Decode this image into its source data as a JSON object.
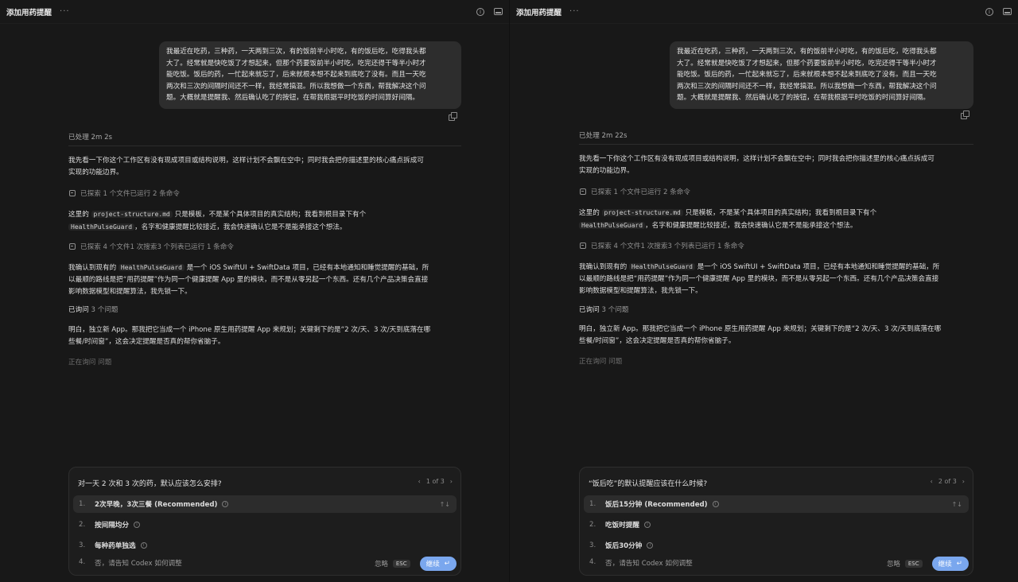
{
  "app": {
    "title": "添加用药提醒",
    "more": "···"
  },
  "conversation": {
    "user_message_lines": [
      "我最近在吃药，三种药，一天两到三次，有的饭前半小时吃，有的饭后吃，吃得我头都",
      "大了。经常就是快吃饭了才想起来，但那个药要饭前半小时吃，吃完还得干等半小时才",
      "能吃饭。饭后的药，一忙起来就忘了，后来就根本想不起来到底吃了没有。而且一天吃",
      "两次和三次的间隔时间还不一样，我经常搞混。所以我想做一个东西，帮我解决这个问",
      "题。大概就是提醒我、然后确认吃了的按钮，在帮我根据平时吃饭的时间算好间隔。"
    ],
    "intro_lines": [
      "我先看一下你这个工作区有没有现成项目或结构说明，这样计划不会飘在空中；同时我会把你描述里的核心痛点拆成可",
      "实现的功能边界。"
    ],
    "explore1": "已探索 1 个文件已运行 2 条命令",
    "para2": {
      "a": "这里的",
      "code1": "project-structure.md",
      "b": "只是模板，不是某个具体项目的真实结构；我看到根目录下有个",
      "code2": "HealthPulseGuard",
      "c": "，名字和健康提醒比较接近，我会快速确认它是不是能承接这个想法。"
    },
    "explore2": "已探索 4 个文件1 次搜索3 个列表已运行 1 条命令",
    "para3": {
      "a": "我确认到现有的",
      "code": "HealthPulseGuard",
      "b": "是一个 iOS SwiftUI + SwiftData 项目，已经有本地通知和睡觉提醒的基础，所",
      "line2": "以最顺的路线是把“用药提醒”作为同一个健康提醒 App 里的模块，而不是从零另起一个东西。还有几个产品决策会直接",
      "line3": "影响数据模型和提醒算法，我先锁一下。"
    },
    "asked_prefix": "已询问",
    "asked_count": "3 个问题",
    "para4_lines": [
      "明白，独立新 App。那我把它当成一个 iPhone 原生用药提醒 App 来规划；关键剩下的是“2 次/天、3 次/天到底落在哪",
      "些餐/时间窗”，这会决定提醒是否真的帮你省脑子。"
    ],
    "asking_prefix": "正在询问",
    "asking_suffix": "问题"
  },
  "panes": [
    {
      "elapsed": "已处理 2m 2s",
      "question": {
        "title": "对一天 2 次和 3 次的药，默认应该怎么安排?",
        "pager": "1 of 3",
        "options": [
          {
            "num": "1.",
            "label": "2次早晚，3次三餐 (Recommended)"
          },
          {
            "num": "2.",
            "label": "按间隔均分"
          },
          {
            "num": "3.",
            "label": "每种药单独选"
          }
        ]
      }
    },
    {
      "elapsed": "已处理 2m 22s",
      "question": {
        "title": "“饭后吃”的默认提醒应该在什么时候?",
        "pager": "2 of 3",
        "options": [
          {
            "num": "1.",
            "label": "饭后15分钟 (Recommended)"
          },
          {
            "num": "2.",
            "label": "吃饭时提醒"
          },
          {
            "num": "3.",
            "label": "饭后30分钟"
          }
        ]
      }
    }
  ],
  "footer": {
    "other_num": "4.",
    "other_label": "否，请告知 Codex 如何调整",
    "ignore": "忽略",
    "esc": "ESC",
    "continue": "继续",
    "continue_icon": "↵"
  },
  "icons": {
    "info": "info-icon",
    "panel": "panel-icon",
    "copy": "copy-icon",
    "prev": "‹",
    "next": "›",
    "updown": "↑↓"
  }
}
